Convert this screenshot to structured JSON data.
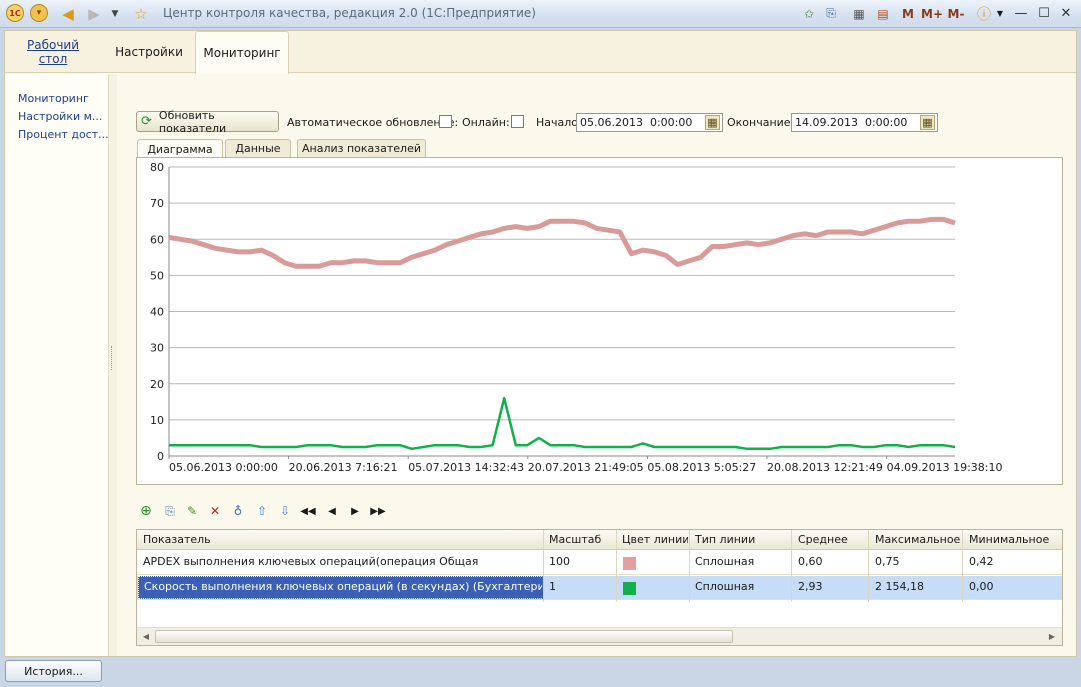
{
  "window": {
    "title": "Центр контроля качества, редакция 2.0  (1С:Предприятие)",
    "logo_text": "1С"
  },
  "sections": {
    "desktop_line1": "Рабочий",
    "desktop_line2": "стол",
    "settings": "Настройки",
    "monitoring": "Мониторинг"
  },
  "nav": {
    "item1": "Мониторинг",
    "item2": "Настройки м...",
    "item3": "Процент дост..."
  },
  "toolbar": {
    "refresh_label": "Обновить показатели",
    "auto_update_label": "Автоматическое обновление:",
    "auto_update_checked": false,
    "online_label": "Онлайн:",
    "online_checked": false,
    "start_label": "Начало:",
    "start_value": "05.06.2013  0:00:00",
    "end_label": "Окончание:",
    "end_value": "14.09.2013  0:00:00"
  },
  "inner_tabs": {
    "chart": "Диаграмма",
    "data": "Данные",
    "analysis": "Анализ показателей"
  },
  "chart_data": {
    "type": "line",
    "ylim": [
      0,
      80
    ],
    "y_ticks": [
      "0",
      "10",
      "20",
      "30",
      "40",
      "50",
      "60",
      "70",
      "80"
    ],
    "x_tick_labels": [
      "05.06.2013 0:00:00",
      "20.06.2013 7:16:21",
      "05.07.2013 14:32:43",
      "20.07.2013 21:49:05",
      "05.08.2013 5:05:27",
      "20.08.2013 12:21:49",
      "04.09.2013 19:38:10"
    ],
    "grid": true,
    "series": [
      {
        "color": "#d99a9a",
        "values": [
          60.5,
          60,
          59.5,
          58.5,
          57.5,
          57,
          56.5,
          56.5,
          57,
          55.5,
          53.5,
          52.5,
          52.5,
          52.5,
          53.5,
          53.5,
          54,
          54,
          53.5,
          53.5,
          53.5,
          55,
          56,
          57,
          58.5,
          59.5,
          60.5,
          61.5,
          62,
          63,
          63.5,
          63,
          63.5,
          65,
          65,
          65,
          64.5,
          63,
          62.5,
          62,
          56,
          57,
          56.5,
          55.5,
          53,
          54,
          55,
          58,
          58,
          58.5,
          59,
          58.5,
          59,
          60,
          61,
          61.5,
          61,
          62,
          62,
          62,
          61.5,
          62.5,
          63.5,
          64.5,
          65,
          65,
          65.5,
          65.5,
          64.5
        ]
      },
      {
        "color": "#10b04a",
        "values": [
          3,
          3,
          3,
          3,
          3,
          3,
          3,
          3,
          2.5,
          2.5,
          2.5,
          2.5,
          3,
          3,
          3,
          2.5,
          2.5,
          2.5,
          3,
          3,
          3,
          2,
          2.5,
          3,
          3,
          3,
          2.5,
          2.5,
          3,
          16,
          3,
          3,
          5,
          3,
          3,
          3,
          2.5,
          2.5,
          2.5,
          2.5,
          2.5,
          3.5,
          2.5,
          2.5,
          2.5,
          2.5,
          2.5,
          2.5,
          2.5,
          2.5,
          2,
          2,
          2,
          2.5,
          2.5,
          2.5,
          2.5,
          2.5,
          3,
          3,
          2.5,
          2.5,
          3,
          3,
          2.5,
          3,
          3,
          3,
          2.5
        ]
      }
    ]
  },
  "grid": {
    "columns": [
      "Показатель",
      "Масштаб",
      "Цвет линии",
      "Тип линии",
      "Среднее",
      "Максимальное",
      "Минимальное"
    ],
    "rows": [
      {
        "name": "APDEX выполнения ключевых операций(операция Общая",
        "scale": "100",
        "color": "#e3a0a0",
        "line_type": "Сплошная",
        "avg": "0,60",
        "max": "0,75",
        "min": "0,42"
      },
      {
        "name": "Скорость выполнения ключевых операций (в секундах) (Бухгалтерия",
        "scale": "1",
        "color": "#10b04a",
        "line_type": "Сплошная",
        "avg": "2,93",
        "max": "2 154,18",
        "min": "0,00"
      }
    ]
  },
  "footer": {
    "history_label": "История..."
  }
}
